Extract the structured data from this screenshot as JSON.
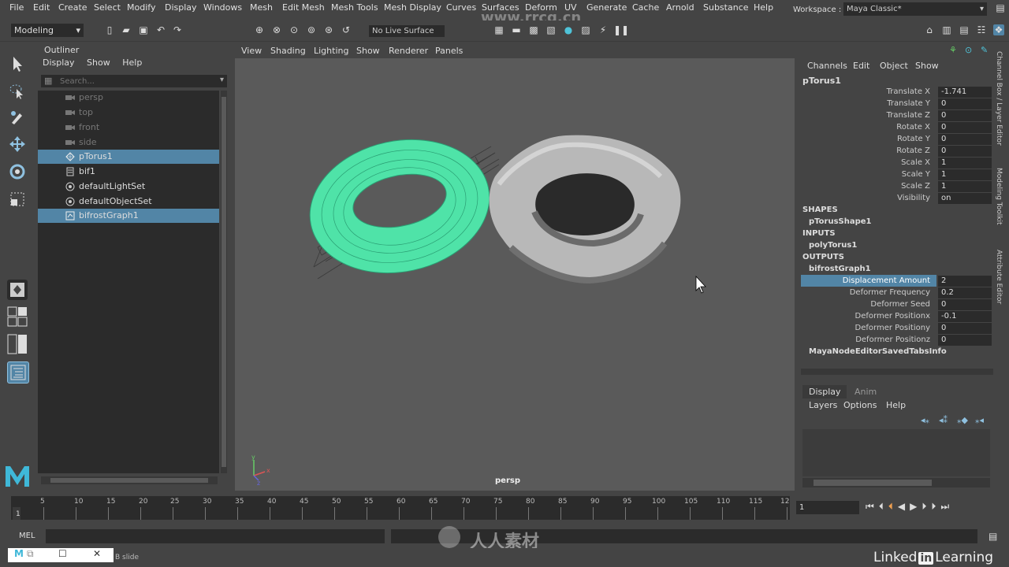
{
  "menubar": {
    "items": [
      "File",
      "Edit",
      "Create",
      "Select",
      "Modify",
      "Display",
      "Windows",
      "Mesh",
      "Edit Mesh",
      "Mesh Tools",
      "Mesh Display",
      "Curves",
      "Surfaces",
      "Deform",
      "UV",
      "Generate",
      "Cache",
      "Arnold",
      "Substance",
      "Help"
    ],
    "workspace_label": "Workspace :",
    "workspace_value": "Maya Classic*"
  },
  "shelf": {
    "mode": "Modeling",
    "live_surface": "No Live Surface"
  },
  "outliner": {
    "title": "Outliner",
    "menu": [
      "Display",
      "Show",
      "Help"
    ],
    "search_placeholder": "Search...",
    "items": [
      {
        "label": "persp",
        "icon": "camera-icon",
        "dim": true,
        "selected": false
      },
      {
        "label": "top",
        "icon": "camera-icon",
        "dim": true,
        "selected": false
      },
      {
        "label": "front",
        "icon": "camera-icon",
        "dim": true,
        "selected": false
      },
      {
        "label": "side",
        "icon": "camera-icon",
        "dim": true,
        "selected": false
      },
      {
        "label": "pTorus1",
        "icon": "mesh-icon",
        "dim": false,
        "selected": true
      },
      {
        "label": "bif1",
        "icon": "bifrost-icon",
        "dim": false,
        "selected": false
      },
      {
        "label": "defaultLightSet",
        "icon": "set-icon",
        "dim": false,
        "selected": false
      },
      {
        "label": "defaultObjectSet",
        "icon": "set-icon",
        "dim": false,
        "selected": false
      },
      {
        "label": "bifrostGraph1",
        "icon": "graph-icon",
        "dim": false,
        "selected": true
      }
    ]
  },
  "viewport": {
    "menu": [
      "View",
      "Shading",
      "Lighting",
      "Show",
      "Renderer",
      "Panels"
    ],
    "camera": "persp",
    "axis_labels": [
      "y",
      "z",
      "x"
    ]
  },
  "channelbox": {
    "menu": [
      "Channels",
      "Edit",
      "Object",
      "Show"
    ],
    "object": "pTorus1",
    "channels": [
      {
        "name": "Translate X",
        "value": "-1.741"
      },
      {
        "name": "Translate Y",
        "value": "0"
      },
      {
        "name": "Translate Z",
        "value": "0"
      },
      {
        "name": "Rotate X",
        "value": "0"
      },
      {
        "name": "Rotate Y",
        "value": "0"
      },
      {
        "name": "Rotate Z",
        "value": "0"
      },
      {
        "name": "Scale X",
        "value": "1"
      },
      {
        "name": "Scale Y",
        "value": "1"
      },
      {
        "name": "Scale Z",
        "value": "1"
      },
      {
        "name": "Visibility",
        "value": "on"
      }
    ],
    "shapes_header": "SHAPES",
    "shape_node": "pTorusShape1",
    "inputs_header": "INPUTS",
    "input_node": "polyTorus1",
    "outputs_header": "OUTPUTS",
    "output_node": "bifrostGraph1",
    "output_attrs": [
      {
        "name": "Displacement Amount",
        "value": "2",
        "selected": true
      },
      {
        "name": "Deformer Frequency",
        "value": "0.2",
        "selected": false
      },
      {
        "name": "Deformer Seed",
        "value": "0",
        "selected": false
      },
      {
        "name": "Deformer Positionx",
        "value": "-0.1",
        "selected": false
      },
      {
        "name": "Deformer Positiony",
        "value": "0",
        "selected": false
      },
      {
        "name": "Deformer Positionz",
        "value": "0",
        "selected": false
      }
    ],
    "extra_node": "MayaNodeEditorSavedTabsInfo"
  },
  "layers": {
    "tabs": [
      "Display",
      "Anim"
    ],
    "menu": [
      "Layers",
      "Options",
      "Help"
    ]
  },
  "side_tabs": [
    "Channel Box / Layer Editor",
    "Modeling Toolkit",
    "Attribute Editor"
  ],
  "timeline": {
    "ticks": [
      "5",
      "10",
      "15",
      "20",
      "25",
      "30",
      "35",
      "40",
      "45",
      "50",
      "55",
      "60",
      "65",
      "70",
      "75",
      "80",
      "85",
      "90",
      "95",
      "100",
      "105",
      "110",
      "115",
      "12"
    ],
    "start_frame": "1",
    "current_frame": "1"
  },
  "cmdbar": {
    "mel_label": "MEL"
  },
  "helpline": {
    "text": "B slide"
  },
  "branding": {
    "linkedin_pre": "Linked",
    "linkedin_in": "in",
    "linkedin_post": "Learning",
    "watermark": "www.rrcg.cn",
    "stamp": "人人素材"
  },
  "colors": {
    "selection": "#5285a6",
    "wire_green": "#4fe3a8",
    "panel": "#444444",
    "field": "#2b2b2b"
  }
}
